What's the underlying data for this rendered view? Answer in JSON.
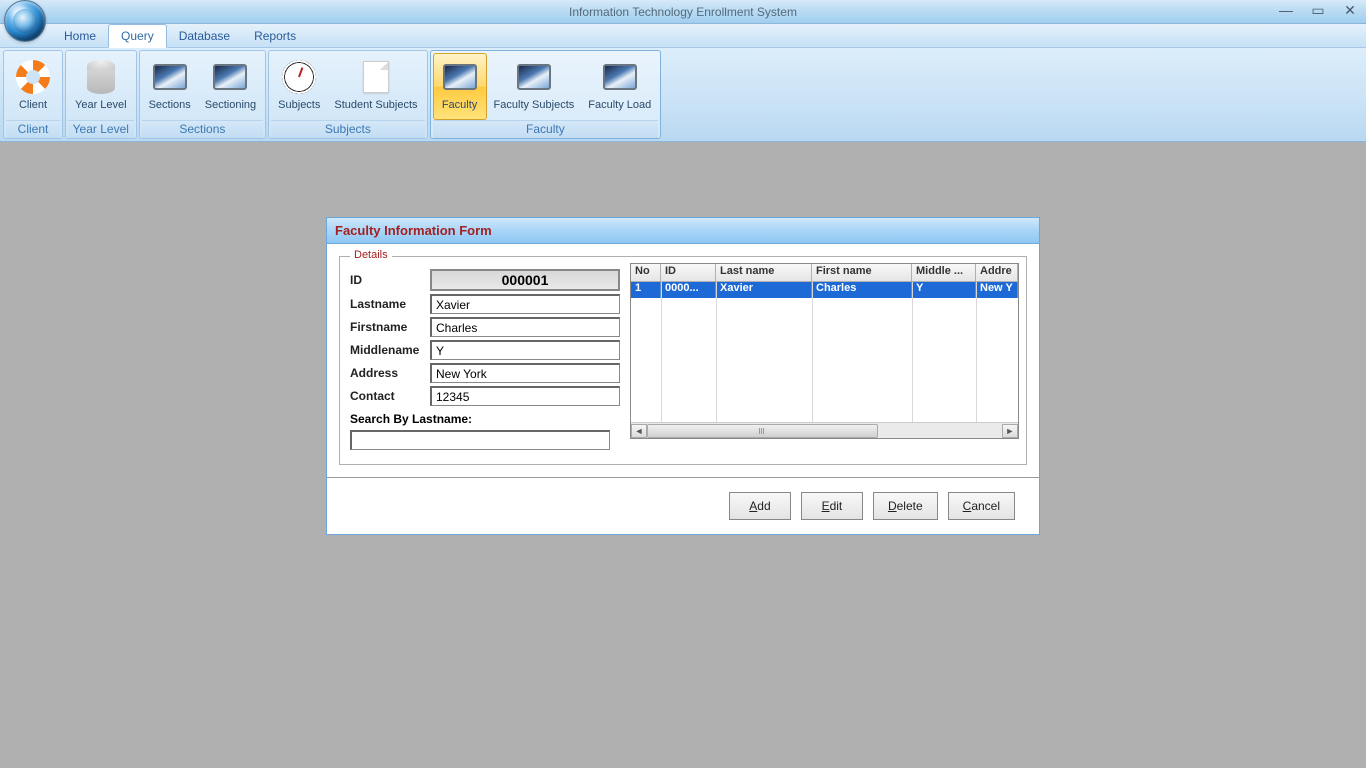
{
  "title": "Information Technology Enrollment System",
  "menu": {
    "items": [
      "Home",
      "Query",
      "Database",
      "Reports"
    ],
    "active_index": 1
  },
  "ribbon": {
    "groups": [
      {
        "label": "Client",
        "buttons": [
          {
            "label": "Client",
            "icon": "lifebuoy-icon"
          }
        ]
      },
      {
        "label": "Year Level",
        "buttons": [
          {
            "label": "Year Level",
            "icon": "database-icon"
          }
        ]
      },
      {
        "label": "Sections",
        "buttons": [
          {
            "label": "Sections",
            "icon": "monitor-icon"
          },
          {
            "label": "Sectioning",
            "icon": "monitor-icon"
          }
        ]
      },
      {
        "label": "Subjects",
        "buttons": [
          {
            "label": "Subjects",
            "icon": "clock-icon"
          },
          {
            "label": "Student Subjects",
            "icon": "document-icon"
          }
        ]
      },
      {
        "label": "Faculty",
        "buttons": [
          {
            "label": "Faculty",
            "icon": "monitor-icon",
            "selected": true
          },
          {
            "label": "Faculty Subjects",
            "icon": "monitor-icon"
          },
          {
            "label": "Faculty Load",
            "icon": "monitor-icon"
          }
        ]
      }
    ]
  },
  "form": {
    "title": "Faculty Information Form",
    "legend": "Details",
    "fields": {
      "id_label": "ID",
      "id_value": "000001",
      "lastname_label": "Lastname",
      "lastname_value": "Xavier",
      "firstname_label": "Firstname",
      "firstname_value": "Charles",
      "middlename_label": "Middlename",
      "middlename_value": "Y",
      "address_label": "Address",
      "address_value": "New York",
      "contact_label": "Contact",
      "contact_value": "12345",
      "search_label": "Search By Lastname:",
      "search_value": ""
    },
    "table": {
      "columns": [
        "No",
        "ID",
        "Last name",
        "First name",
        "Middle ...",
        "Addre"
      ],
      "rows": [
        {
          "no": "1",
          "id": "0000...",
          "lastname": "Xavier",
          "firstname": "Charles",
          "middlename": "Y",
          "address": "New Y"
        }
      ]
    },
    "buttons": {
      "add": "Add",
      "edit": "Edit",
      "delete": "Delete",
      "cancel": "Cancel"
    }
  }
}
